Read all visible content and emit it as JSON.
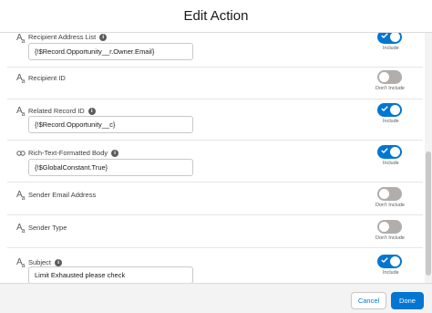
{
  "modal": {
    "title": "Edit Action"
  },
  "fields": [
    {
      "type_icon": "text-type-icon",
      "label": "Recipient Address List",
      "has_info": true,
      "value": "{!$Record.Opportunity__r.Owner.Email}",
      "toggle_on": true,
      "toggle_label": "Include"
    },
    {
      "type_icon": "text-type-icon",
      "label": "Recipient ID",
      "has_info": false,
      "value": null,
      "toggle_on": false,
      "toggle_label": "Don't Include"
    },
    {
      "type_icon": "text-type-icon",
      "label": "Related Record ID",
      "has_info": true,
      "value": "{!$Record.Opportunity__c}",
      "toggle_on": true,
      "toggle_label": "Include"
    },
    {
      "type_icon": "boolean-type-icon",
      "label": "Rich-Text-Formatted Body",
      "has_info": true,
      "value": "{!$GlobalConstant.True}",
      "toggle_on": true,
      "toggle_label": "Include"
    },
    {
      "type_icon": "text-type-icon",
      "label": "Sender Email Address",
      "has_info": false,
      "value": null,
      "toggle_on": false,
      "toggle_label": "Don't Include"
    },
    {
      "type_icon": "text-type-icon",
      "label": "Sender Type",
      "has_info": false,
      "value": null,
      "toggle_on": false,
      "toggle_label": "Don't Include"
    },
    {
      "type_icon": "text-type-icon",
      "label": "Subject",
      "has_info": true,
      "value": "Limit Exhausted please check",
      "toggle_on": true,
      "toggle_label": "Include"
    }
  ],
  "footer": {
    "cancel_label": "Cancel",
    "done_label": "Done"
  },
  "colors": {
    "brand": "#0176d3",
    "toggle_off": "#b0adab"
  }
}
